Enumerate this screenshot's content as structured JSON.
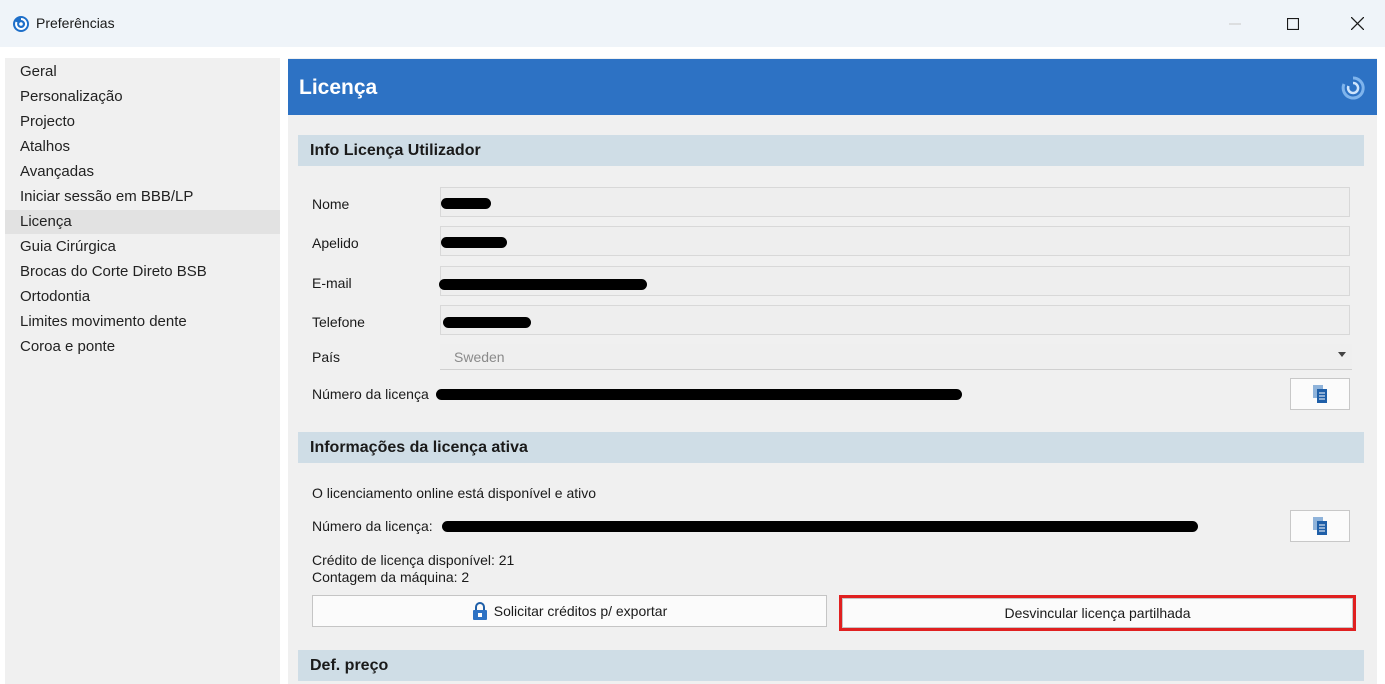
{
  "window": {
    "title": "Preferências",
    "app_icon": "app-logo-icon",
    "controls": [
      "minimize-icon",
      "maximize-icon",
      "close-icon"
    ]
  },
  "sidebar": {
    "items": [
      {
        "label": "Geral"
      },
      {
        "label": "Personalização"
      },
      {
        "label": "Projecto"
      },
      {
        "label": "Atalhos"
      },
      {
        "label": "Avançadas"
      },
      {
        "label": "Iniciar sessão em BBB/LP"
      },
      {
        "label": "Licença",
        "active": true
      },
      {
        "label": "Guia Cirúrgica"
      },
      {
        "label": "Brocas do Corte Direto BSB"
      },
      {
        "label": "Ortodontia"
      },
      {
        "label": "Limites movimento dente"
      },
      {
        "label": "Coroa e ponte"
      }
    ]
  },
  "main": {
    "title": "Licença",
    "header_color": "#2d72c4",
    "user_info": {
      "heading": "Info Licença Utilizador",
      "name_label": "Nome",
      "surname_label": "Apelido",
      "email_label": "E-mail",
      "phone_label": "Telefone",
      "country_label": "País",
      "country_value": "Sweden",
      "license_number_label": "Número da licença"
    },
    "active_license": {
      "heading": "Informações da licença ativa",
      "status_text": "O licenciamento online está disponível e ativo",
      "license_number_label": "Número da licença:",
      "credit_text": "Crédito de licença disponível: 21",
      "machine_count_text": "Contagem da máquina: 2",
      "request_button": "Solicitar créditos p/ exportar",
      "unlink_button": "Desvincular licença partilhada"
    },
    "price_section": {
      "heading": "Def. preço"
    },
    "highlight_color": "#e02020"
  }
}
